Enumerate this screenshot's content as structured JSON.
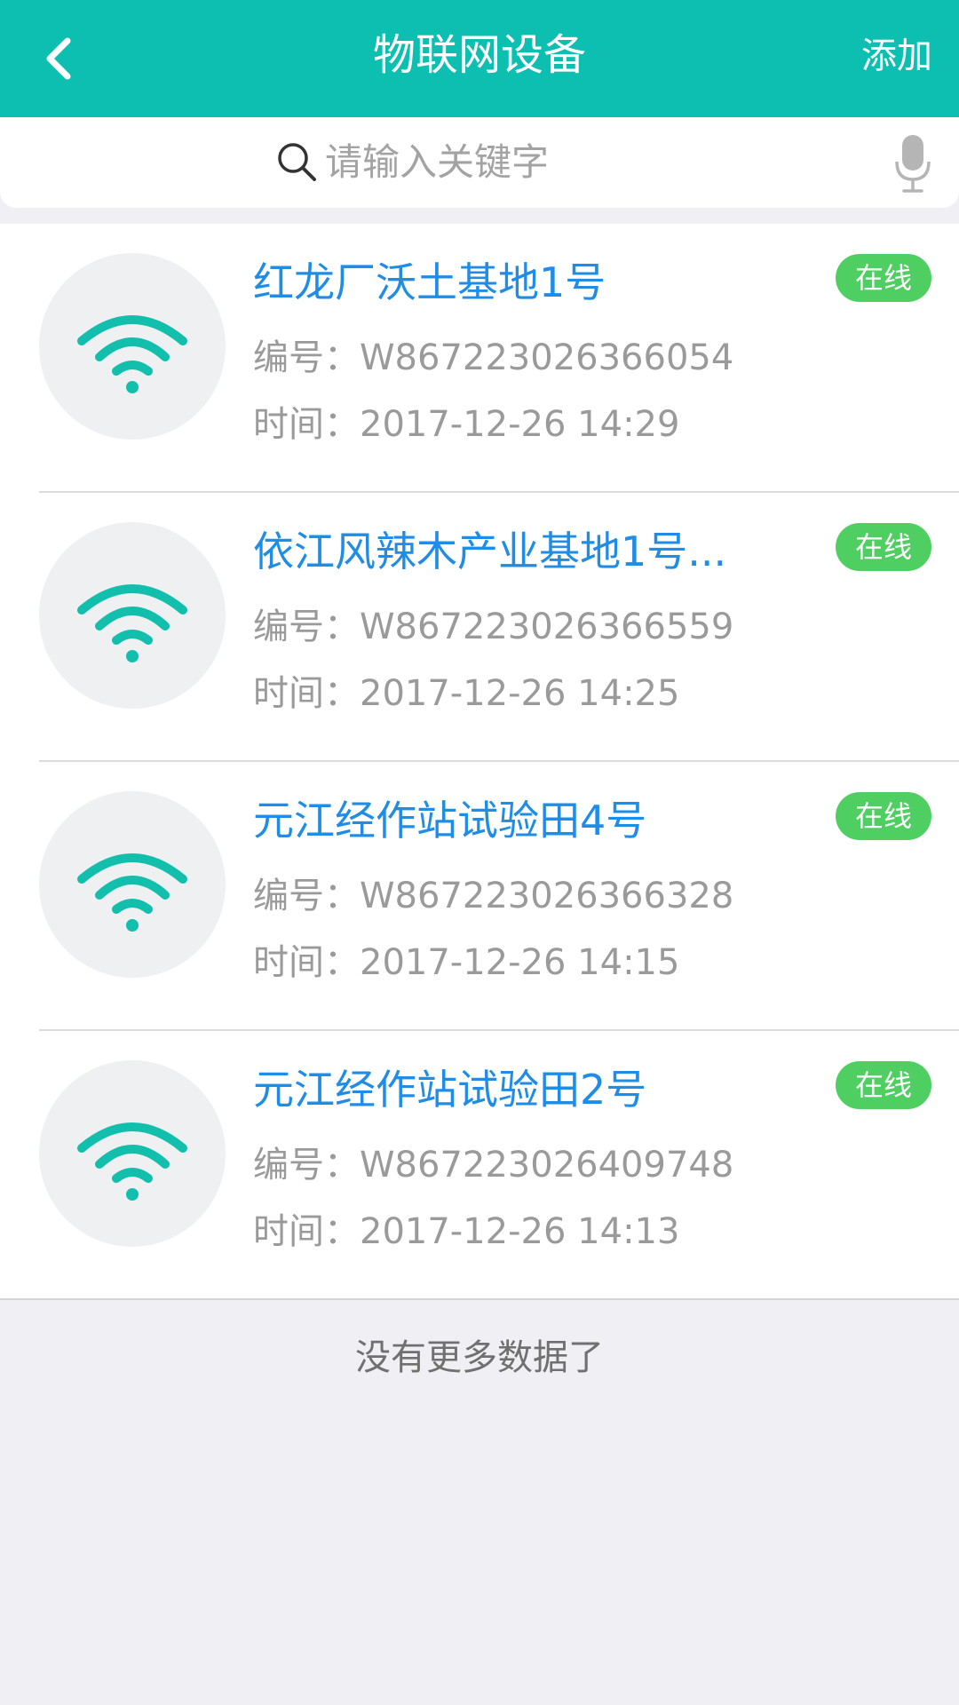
{
  "header": {
    "title": "物联网设备",
    "add_label": "添加",
    "back_icon": "chevron-left-icon",
    "background_color": "#0cbfb0"
  },
  "search": {
    "placeholder": "请输入关键字",
    "value": "",
    "search_icon": "search-icon",
    "mic_icon": "microphone-icon"
  },
  "devices": [
    {
      "name": "红龙厂沃土基地1号",
      "code": "编号：W867223026366054",
      "time": "时间：2017-12-26 14:29",
      "status": "在线",
      "icon": "wifi-icon"
    },
    {
      "name": "依江风辣木产业基地1号...",
      "code": "编号：W867223026366559",
      "time": "时间：2017-12-26 14:25",
      "status": "在线",
      "icon": "wifi-icon"
    },
    {
      "name": "元江经作站试验田4号",
      "code": "编号：W867223026366328",
      "time": "时间：2017-12-26 14:15",
      "status": "在线",
      "icon": "wifi-icon"
    },
    {
      "name": "元江经作站试验田2号",
      "code": "编号：W867223026409748",
      "time": "时间：2017-12-26 14:13",
      "status": "在线",
      "icon": "wifi-icon"
    }
  ],
  "footer": {
    "no_more_text": "没有更多数据了"
  },
  "colors": {
    "accent": "#0cbfb0",
    "title_blue": "#1f8ce6",
    "online_green": "#4fcf61",
    "page_background": "#efeff4"
  }
}
